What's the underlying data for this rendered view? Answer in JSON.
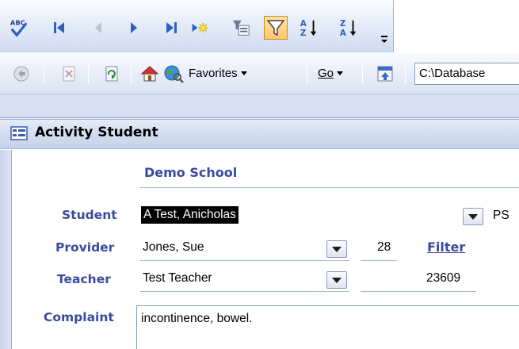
{
  "toolbar_nav": {
    "buttons": [
      {
        "name": "spelling-check",
        "icon": "abc-check-icon"
      },
      {
        "name": "first-record",
        "icon": "first-icon"
      },
      {
        "name": "previous-record",
        "icon": "previous-icon"
      },
      {
        "name": "next-record",
        "icon": "next-icon"
      },
      {
        "name": "last-record",
        "icon": "last-icon"
      },
      {
        "name": "new-record",
        "icon": "new-record-icon"
      },
      {
        "name": "filter-by-form",
        "icon": "filter-form-icon"
      },
      {
        "name": "apply-filter",
        "icon": "funnel-icon"
      },
      {
        "name": "sort-ascending",
        "icon": "sort-az-icon"
      },
      {
        "name": "sort-descending",
        "icon": "sort-za-icon"
      }
    ]
  },
  "toolbar_web": {
    "favorites_label": "Favorites",
    "go_label": "Go",
    "address_value": "C:\\Database"
  },
  "form": {
    "title": "Activity Student",
    "school_name": "Demo School",
    "student_label": "Student",
    "student_value": "A Test, Anicholas",
    "student_extra": "PS",
    "provider_label": "Provider",
    "provider_value": "Jones, Sue",
    "provider_number": "28",
    "filter_label": "Filter",
    "teacher_label": "Teacher",
    "teacher_value": "Test Teacher",
    "teacher_number": "23609",
    "complaint_label": "Complaint",
    "complaint_value": "incontinence, bowel."
  },
  "colors": {
    "label_blue": "#3a4a9c",
    "toolbar_blue": "#2f5fc4",
    "highlight_orange": "#ffc86a"
  }
}
